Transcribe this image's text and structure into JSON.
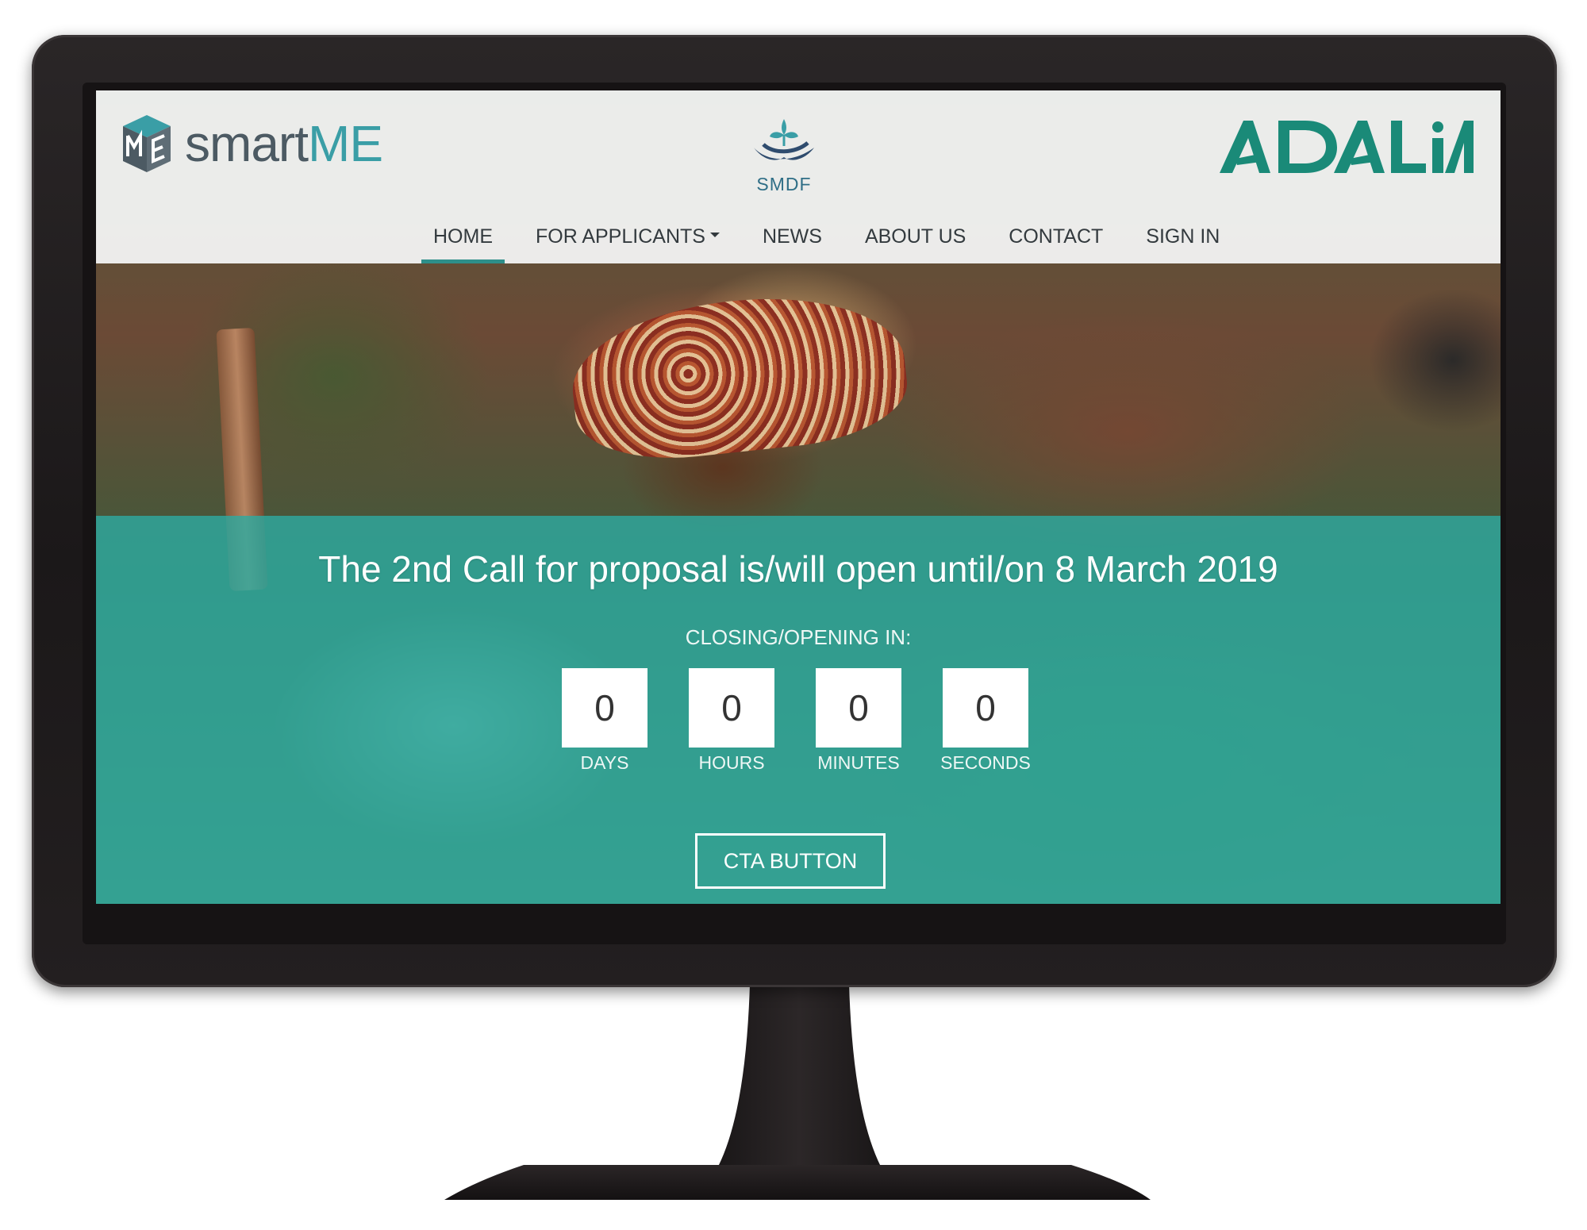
{
  "header": {
    "logo_left": {
      "part1": "smart",
      "part2": "ME"
    },
    "logo_center": {
      "text": "SMDF"
    },
    "logo_right": {
      "text": "ADALIA"
    }
  },
  "nav": {
    "items": [
      {
        "label": "HOME",
        "active": true
      },
      {
        "label": "FOR APPLICANTS",
        "dropdown": true
      },
      {
        "label": "NEWS"
      },
      {
        "label": "ABOUT US"
      },
      {
        "label": "CONTACT"
      },
      {
        "label": "SIGN IN"
      }
    ]
  },
  "hero": {
    "title": "The 2nd Call for proposal is/will open until/on 8 March 2019",
    "countdown_label": "CLOSING/OPENING IN:",
    "countdown": [
      {
        "value": "0",
        "unit": "DAYS"
      },
      {
        "value": "0",
        "unit": "HOURS"
      },
      {
        "value": "0",
        "unit": "MINUTES"
      },
      {
        "value": "0",
        "unit": "SECONDS"
      }
    ],
    "cta_label": "CTA BUTTON"
  },
  "colors": {
    "accent_teal": "#2eaaa0",
    "nav_underline": "#2e8f8a",
    "logo_grey": "#4c5a63",
    "logo_teal": "#3a9ea6",
    "adalia_green": "#1a8a78",
    "monitor_frame": "#231f20"
  }
}
